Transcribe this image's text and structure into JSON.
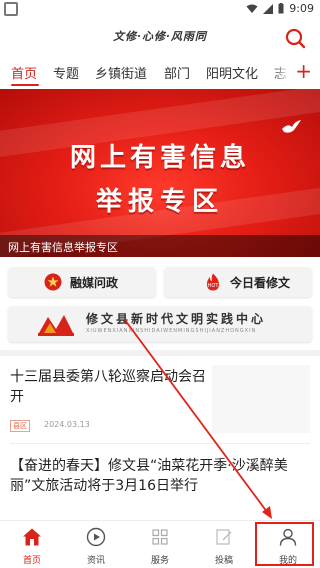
{
  "status_bar": {
    "time": "9:09"
  },
  "header": {
    "slogan": "文修·心修·风雨同"
  },
  "nav_tabs": [
    {
      "label": "首页",
      "active": true
    },
    {
      "label": "专题"
    },
    {
      "label": "乡镇街道"
    },
    {
      "label": "部门"
    },
    {
      "label": "阳明文化"
    },
    {
      "label": "志"
    }
  ],
  "banner": {
    "line1": "网上有害信息",
    "line2": "举报专区",
    "caption": "网上有害信息举报专区"
  },
  "quick_buttons": [
    {
      "label": "融媒问政",
      "icon": "star-badge-icon"
    },
    {
      "label": "今日看修文",
      "icon": "flame-icon"
    }
  ],
  "practice_center": {
    "title": "修文县新时代文明实践中心",
    "pinyin": "XIUWENXIANXINSHIDAIWENMINGSHIJIANZHONGXIN"
  },
  "news": [
    {
      "title": "十三届县委第八轮巡察启动会召开",
      "tag": "县区",
      "date": "2024.03.13"
    },
    {
      "title": "【奋进的春天】修文县“油菜花开季·沙溪醉美丽”文旅活动将于3月16日举行"
    }
  ],
  "tab_bar": [
    {
      "label": "首页",
      "icon": "home-icon",
      "active": true
    },
    {
      "label": "资讯",
      "icon": "play-circle-icon"
    },
    {
      "label": "服务",
      "icon": "grid-icon"
    },
    {
      "label": "投稿",
      "icon": "edit-icon"
    },
    {
      "label": "我的",
      "icon": "user-icon"
    }
  ],
  "colors": {
    "accent": "#d8231b",
    "banner_red": "#e51e16",
    "annotation": "#e1221b"
  }
}
